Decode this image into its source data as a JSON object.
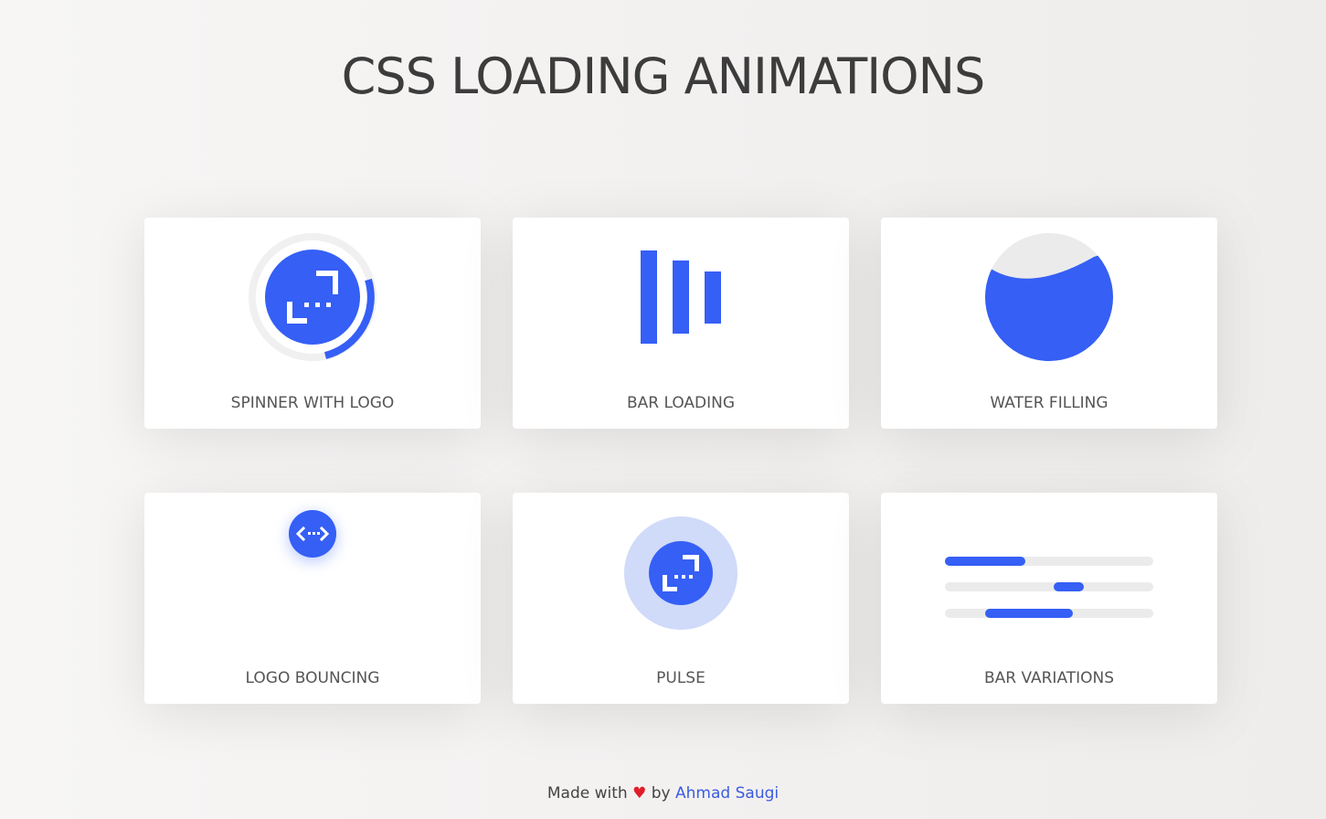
{
  "page": {
    "title": "CSS LOADING ANIMATIONS"
  },
  "cards": [
    {
      "label": "SPINNER WITH LOGO"
    },
    {
      "label": "BAR LOADING"
    },
    {
      "label": "WATER FILLING"
    },
    {
      "label": "LOGO BOUNCING"
    },
    {
      "label": "PULSE"
    },
    {
      "label": "BAR VARIATIONS"
    }
  ],
  "footer": {
    "made_with": "Made with",
    "heart": "♥",
    "by": "by",
    "author": "Ahmad Saugi"
  },
  "colors": {
    "accent": "#355ff5",
    "track": "#ebebeb",
    "pulse_halo": "#d0daf9",
    "heart": "#e11d2a",
    "link": "#3a5be0"
  },
  "icons": [
    "logo-icon",
    "heart-icon"
  ]
}
